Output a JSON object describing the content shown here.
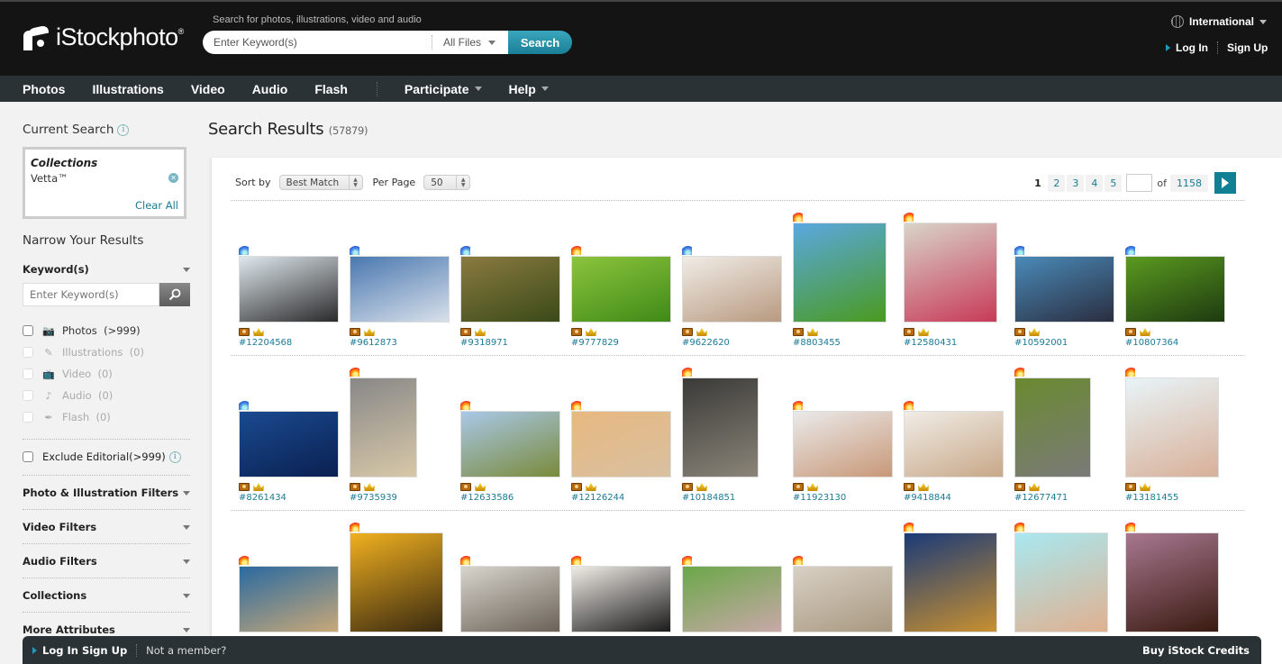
{
  "header": {
    "logo": "iStockphoto",
    "logo_mark": "®",
    "search_hint": "Search for photos, illustrations, video and audio",
    "search_placeholder": "Enter Keyword(s)",
    "file_type": "All Files",
    "search_button": "Search",
    "region": "International",
    "login": "Log In",
    "signup": "Sign Up"
  },
  "nav": {
    "items": [
      "Photos",
      "Illustrations",
      "Video",
      "Audio",
      "Flash"
    ],
    "dropdowns": [
      "Participate",
      "Help"
    ]
  },
  "sidebar": {
    "current_search_title": "Current Search",
    "collections_label": "Collections",
    "collections_value": "Vetta™",
    "clear_all": "Clear All",
    "narrow_title": "Narrow Your Results",
    "keyword_label": "Keyword(s)",
    "keyword_placeholder": "Enter Keyword(s)",
    "types": [
      {
        "label": "Photos",
        "count": "(>999)",
        "icon": "camera-icon",
        "enabled": true
      },
      {
        "label": "Illustrations",
        "count": "(0)",
        "icon": "pen-icon",
        "enabled": false
      },
      {
        "label": "Video",
        "count": "(0)",
        "icon": "tv-icon",
        "enabled": false
      },
      {
        "label": "Audio",
        "count": "(0)",
        "icon": "music-note-icon",
        "enabled": false
      },
      {
        "label": "Flash",
        "count": "(0)",
        "icon": "feather-icon",
        "enabled": false
      }
    ],
    "exclude_editorial": "Exclude Editorial(>999)",
    "filters": [
      "Photo & Illustration Filters",
      "Video Filters",
      "Audio Filters",
      "Collections",
      "More Attributes"
    ]
  },
  "main": {
    "title": "Search Results",
    "count": "(57879)",
    "sort_label": "Sort by",
    "sort_value": "Best Match",
    "per_page_label": "Per Page",
    "per_page_value": "50",
    "pager": {
      "current": "1",
      "pages": [
        "2",
        "3",
        "4",
        "5"
      ],
      "of_label": "of",
      "total": "1158"
    },
    "rows": [
      [
        {
          "id": "#12204568",
          "flame": "blue",
          "shape": "landscape",
          "colors": [
            "#dfe8ee",
            "#2a2a2a"
          ]
        },
        {
          "id": "#9612873",
          "flame": "blue",
          "shape": "landscape",
          "colors": [
            "#4a78b0",
            "#d8e0ea"
          ]
        },
        {
          "id": "#9318971",
          "flame": "blue",
          "shape": "landscape",
          "colors": [
            "#8a7a40",
            "#3a4a18"
          ]
        },
        {
          "id": "#9777829",
          "flame": "fire",
          "shape": "landscape",
          "colors": [
            "#8cc43c",
            "#3f8a18"
          ]
        },
        {
          "id": "#9622620",
          "flame": "blue",
          "shape": "landscape",
          "colors": [
            "#f0ece6",
            "#b89a80"
          ]
        },
        {
          "id": "#8803455",
          "flame": "fire",
          "shape": "square",
          "colors": [
            "#5aa8e0",
            "#4a9a20"
          ]
        },
        {
          "id": "#12580431",
          "flame": "fire",
          "shape": "square",
          "colors": [
            "#d8d4c8",
            "#c83a58"
          ]
        },
        {
          "id": "#10592001",
          "flame": "blue",
          "shape": "landscape",
          "colors": [
            "#4a8ab8",
            "#2a2e40"
          ]
        },
        {
          "id": "#10807364",
          "flame": "blue",
          "shape": "landscape",
          "colors": [
            "#5a9a20",
            "#1e3a10"
          ]
        }
      ],
      [
        {
          "id": "#8261434",
          "flame": "blue",
          "shape": "landscape",
          "colors": [
            "#1a4a90",
            "#0a2050"
          ]
        },
        {
          "id": "#9735939",
          "flame": "fire",
          "shape": "portrait",
          "colors": [
            "#888",
            "#d8c8a8"
          ]
        },
        {
          "id": "#12633586",
          "flame": "fire",
          "shape": "landscape",
          "colors": [
            "#a8c8e8",
            "#7a8a3a"
          ]
        },
        {
          "id": "#12126244",
          "flame": "fire",
          "shape": "landscape",
          "colors": [
            "#e8b880",
            "#d8c0a0"
          ]
        },
        {
          "id": "#10184851",
          "flame": "fire",
          "shape": "portrait-tall",
          "colors": [
            "#3a3a38",
            "#8a8478"
          ]
        },
        {
          "id": "#11923130",
          "flame": "fire",
          "shape": "landscape",
          "colors": [
            "#eaeaea",
            "#c89878"
          ]
        },
        {
          "id": "#9418844",
          "flame": "fire",
          "shape": "landscape",
          "colors": [
            "#f0ece6",
            "#c8a888"
          ]
        },
        {
          "id": "#12677471",
          "flame": "fire",
          "shape": "portrait-tall",
          "colors": [
            "#6a8a30",
            "#7a7a78"
          ]
        },
        {
          "id": "#13181455",
          "flame": "fire",
          "shape": "square",
          "colors": [
            "#e8f4f8",
            "#d8b098"
          ]
        }
      ],
      [
        {
          "id": "",
          "flame": "fire",
          "shape": "landscape",
          "colors": [
            "#2a6aa0",
            "#c8a878"
          ]
        },
        {
          "id": "",
          "flame": "fire",
          "shape": "square",
          "colors": [
            "#f0b020",
            "#3a2a10"
          ]
        },
        {
          "id": "",
          "flame": "fire",
          "shape": "landscape",
          "colors": [
            "#d8d4cc",
            "#6a6258"
          ]
        },
        {
          "id": "",
          "flame": "fire",
          "shape": "landscape",
          "colors": [
            "#f0ece6",
            "#1a1a1a"
          ]
        },
        {
          "id": "",
          "flame": "fire",
          "shape": "landscape",
          "colors": [
            "#6aa848",
            "#c8a8a8"
          ]
        },
        {
          "id": "",
          "flame": "fire",
          "shape": "landscape",
          "colors": [
            "#d8d0c4",
            "#a89880"
          ]
        },
        {
          "id": "",
          "flame": "fire",
          "shape": "square",
          "colors": [
            "#1a3a78",
            "#c89030"
          ]
        },
        {
          "id": "",
          "flame": "fire",
          "shape": "square",
          "colors": [
            "#a8e8f0",
            "#e0b090"
          ]
        },
        {
          "id": "",
          "flame": "fire",
          "shape": "square",
          "colors": [
            "#a87890",
            "#3a1a10"
          ]
        }
      ]
    ]
  },
  "bottom_bar": {
    "login": "Log In",
    "signup": "Sign Up",
    "not_member": "Not a member?",
    "buy_credits": "Buy iStock Credits"
  },
  "colors": {
    "header_bg": "#141414",
    "nav_bg": "#2a3235",
    "accent": "#1a7a96",
    "search_button": "#2a93ac"
  }
}
